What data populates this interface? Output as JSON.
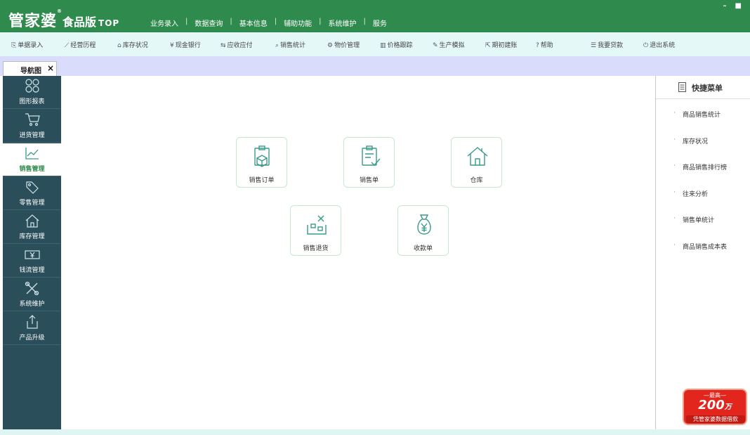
{
  "app": {
    "logo_main": "管家婆",
    "logo_edition": "食品版",
    "logo_suffix": "TOP",
    "logo_mark": "®"
  },
  "window_controls": [
    "–",
    "■"
  ],
  "top_menu": [
    "业务录入",
    "数据查询",
    "基本信息",
    "辅助功能",
    "系统维护",
    "服务"
  ],
  "top_menu_separator": "|",
  "toolbar": [
    {
      "icon": "form-icon",
      "glyph": "⎘",
      "label": "单据录入"
    },
    {
      "icon": "chart-line-icon",
      "glyph": "⟋",
      "label": "经营历程"
    },
    {
      "icon": "home-icon",
      "glyph": "⌂",
      "label": "库存状况"
    },
    {
      "icon": "yen-icon",
      "glyph": "¥",
      "label": "现金银行"
    },
    {
      "icon": "exchange-icon",
      "glyph": "⇆",
      "label": "应收应付"
    },
    {
      "icon": "search-icon",
      "glyph": "⌕",
      "label": "销售统计"
    },
    {
      "icon": "gear-icon",
      "glyph": "⚙",
      "label": "物价管理"
    },
    {
      "icon": "bar-chart-icon",
      "glyph": "▥",
      "label": "价格跟踪"
    },
    {
      "icon": "wrench-icon",
      "glyph": "✎",
      "label": "生产模拟"
    },
    {
      "icon": "external-icon",
      "glyph": "⇱",
      "label": "期初建账"
    },
    {
      "icon": "help-icon",
      "glyph": "?",
      "label": "帮助"
    },
    {
      "icon": "debt-icon",
      "glyph": "☰",
      "label": "我要贷款"
    },
    {
      "icon": "power-icon",
      "glyph": "⏻",
      "label": "退出系统"
    }
  ],
  "nav_tab": {
    "label": "导航图",
    "close": "×"
  },
  "sidebar": {
    "items": [
      {
        "icon": "graph-report-icon",
        "label": "图形报表",
        "active": false
      },
      {
        "icon": "cart-icon",
        "label": "进货管理",
        "active": false
      },
      {
        "icon": "sales-trend-icon",
        "label": "销售管理",
        "active": true
      },
      {
        "icon": "tag-icon",
        "label": "零售管理",
        "active": false
      },
      {
        "icon": "warehouse-icon",
        "label": "库存管理",
        "active": false
      },
      {
        "icon": "money-icon",
        "label": "钱流管理",
        "active": false
      },
      {
        "icon": "tools-icon",
        "label": "系统维护",
        "active": false
      },
      {
        "icon": "upgrade-icon",
        "label": "产品升级",
        "active": false
      }
    ]
  },
  "main": {
    "cards": [
      {
        "icon": "sales-order-icon",
        "label": "销售订单"
      },
      {
        "icon": "sales-bill-icon",
        "label": "销售单"
      },
      {
        "icon": "warehouse-icon",
        "label": "仓库"
      },
      {
        "icon": "sales-return-icon",
        "label": "销售退货"
      },
      {
        "icon": "money-bag-icon",
        "label": "收款单"
      }
    ]
  },
  "quick_menu": {
    "title": "快捷菜单",
    "bullet": "·",
    "items": [
      "商品销售统计",
      "库存状况",
      "商品销售排行榜",
      "往来分析",
      "销售单统计",
      "商品销售成本表"
    ]
  },
  "promo": {
    "line1": "—最高—",
    "amount": "200",
    "unit": "万",
    "line3": "凭管家婆数据借款"
  },
  "colors": {
    "title_green": "#2f8a4d",
    "toolbar_bg": "#e5f8f8",
    "tabstrip_bg": "#d9dcfa",
    "sidebar_bg": "#2a4e5a",
    "accent_teal": "#3a9a8a",
    "promo_red": "#e2261d"
  }
}
